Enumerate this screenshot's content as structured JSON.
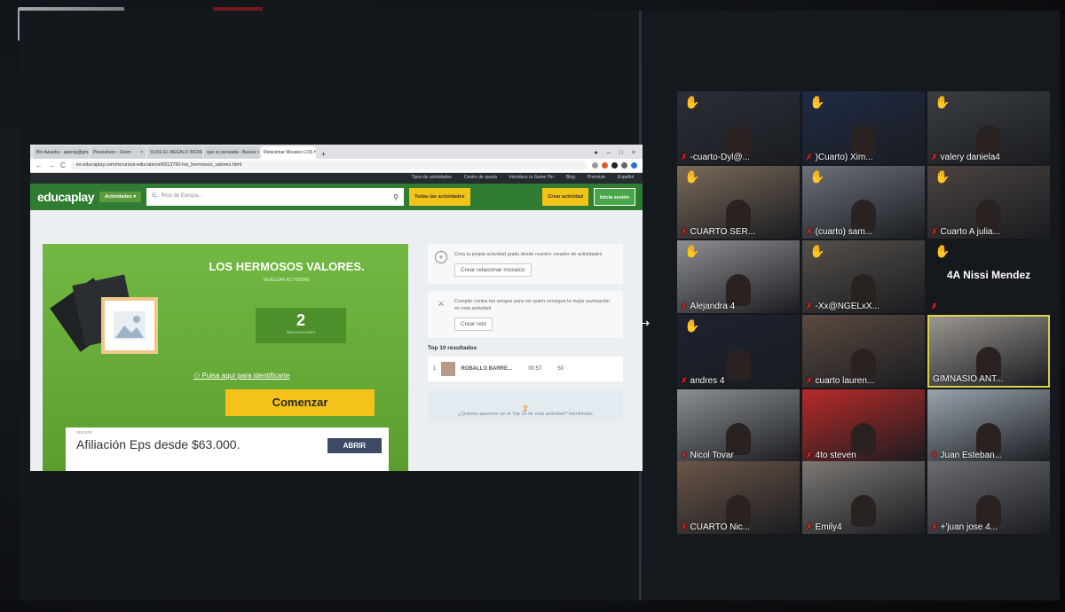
{
  "browser": {
    "tabs": [
      {
        "label": "Bin Awaebu - apereg@gmai...",
        "active": false
      },
      {
        "label": "Pleasehere - Zoom",
        "active": false
      },
      {
        "label": "SUSS EL REGALO INCREIBLE",
        "active": false
      },
      {
        "label": "que es pensada - Buscar con...",
        "active": false
      },
      {
        "label": "Relacionar Mosaico LOS HER...",
        "active": true
      }
    ],
    "new_tab": "+",
    "url": "es.educaplay.com/recursos-educativos/6913790-los_hermosos_valores.html"
  },
  "educaplay": {
    "topnav": [
      "Tipos de actividades",
      "Centro de ayuda",
      "Introduce tu Game Pin",
      "Blog",
      "Premium",
      "Español"
    ],
    "logo": "educaplay",
    "activities_label": "Actividades",
    "search_placeholder": "Ej.: Ríos de Europa...",
    "all_activities": "Todas las actividades",
    "create_activity": "Crear actividad",
    "login": "Inicia sesión",
    "game": {
      "title": "LOS HERMOSOS VALORES.",
      "subtitle": "REALIZAR ACTIVIDAD",
      "attempts": "2",
      "attempts_label": "REALIZACIONES",
      "identify": "Pulsa aquí para identificarte",
      "start": "Comenzar"
    },
    "ad": {
      "tag": "anuncio",
      "text": "Afiliación Eps desde $63.000.",
      "button": "ABRIR"
    },
    "side": {
      "create_text": "Crea tu propia actividad gratis desde nuestro creador de actividades",
      "create_btn": "Crear relacionar mosaico",
      "challenge_text": "Compite contra tus amigos para ver quien consigue la mejor puntuación en esta actividad",
      "challenge_btn": "Crear reto",
      "top10_title": "Top 10 resultados",
      "top10": [
        {
          "rank": "1",
          "name": "ROBALLO BARRE...",
          "time": "00:57",
          "score": "50"
        }
      ],
      "top10_note": "¿Quieres aparecer en el Top 10 de esta actividad? Identifícate"
    }
  },
  "zoom": {
    "participants": [
      {
        "name": "-cuarto-Dyl@...",
        "hand": true,
        "muted": true,
        "bg": "#2b2f36"
      },
      {
        "name": ")Cuarto) Xim...",
        "hand": true,
        "muted": true,
        "bg": "#1f2a44"
      },
      {
        "name": "valery daniela4",
        "hand": true,
        "muted": true,
        "bg": "#3a3d42"
      },
      {
        "name": "CUARTO SER...",
        "hand": true,
        "muted": true,
        "bg": "#7a6a5a"
      },
      {
        "name": "(cuarto) sam...",
        "hand": true,
        "muted": true,
        "bg": "#6c7078"
      },
      {
        "name": "Cuarto A julia...",
        "hand": true,
        "muted": true,
        "bg": "#4b4340"
      },
      {
        "name": "Alejandra 4",
        "hand": true,
        "muted": true,
        "bg": "#8d8e90"
      },
      {
        "name": "-Xx@NGELxX...",
        "hand": true,
        "muted": true,
        "bg": "#55504a"
      },
      {
        "name": "4A Nissi Mendez",
        "hand": true,
        "muted": true,
        "bg": "#15181d",
        "noimg": true
      },
      {
        "name": "andres 4",
        "hand": true,
        "muted": true,
        "bg": "#1c2230"
      },
      {
        "name": "cuarto lauren...",
        "hand": false,
        "muted": true,
        "bg": "#5b4a40"
      },
      {
        "name": "GIMNASIO ANT...",
        "hand": false,
        "muted": false,
        "bg": "#9b9690",
        "active": true
      },
      {
        "name": "Nicol Tovar",
        "hand": false,
        "muted": true,
        "bg": "#8c8f92"
      },
      {
        "name": "4to steven",
        "hand": false,
        "muted": true,
        "bg": "#b82a28"
      },
      {
        "name": "Juan Esteban...",
        "hand": false,
        "muted": true,
        "bg": "#9aa4ae"
      },
      {
        "name": "CUARTO Nic...",
        "hand": false,
        "muted": true,
        "bg": "#6a5548"
      },
      {
        "name": "Emily4",
        "hand": false,
        "muted": true,
        "bg": "#7c7874"
      },
      {
        "name": "+'juan jose 4...",
        "hand": false,
        "muted": true,
        "bg": "#6a6c70"
      }
    ]
  }
}
